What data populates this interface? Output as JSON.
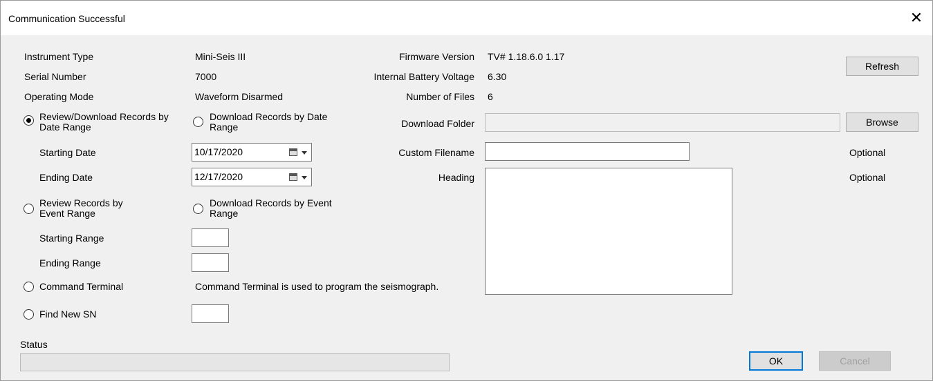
{
  "window": {
    "title": "Communication Successful"
  },
  "info": {
    "instrument_type_label": "Instrument Type",
    "instrument_type_value": "Mini-Seis III",
    "serial_number_label": "Serial Number",
    "serial_number_value": "7000",
    "operating_mode_label": "Operating Mode",
    "operating_mode_value": "Waveform Disarmed",
    "firmware_label": "Firmware Version",
    "firmware_value": "TV# 1.18.6.0 1.17",
    "battery_label": "Internal Battery Voltage",
    "battery_value": "6.30",
    "files_label": "Number of Files",
    "files_value": "6"
  },
  "options": {
    "review_date": "Review/Download Records by Date Range",
    "download_date": "Download Records by Date Range",
    "review_event": "Review Records by Event Range",
    "download_event": "Download Records by Event Range",
    "command_terminal": "Command Terminal",
    "find_sn": "Find New SN",
    "selected": "review_date"
  },
  "dates": {
    "starting_label": "Starting Date",
    "starting_value": "10/17/2020",
    "ending_label": "Ending Date",
    "ending_value": "12/17/2020"
  },
  "ranges": {
    "starting_label": "Starting Range",
    "ending_label": "Ending Range"
  },
  "command_terminal_note": "Command Terminal is used to program the seismograph.",
  "download": {
    "folder_label": "Download Folder",
    "folder_value": "",
    "custom_filename_label": "Custom Filename",
    "custom_filename_value": "",
    "heading_label": "Heading",
    "heading_value": "",
    "optional_1": "Optional",
    "optional_2": "Optional"
  },
  "status": {
    "label": "Status",
    "progress": 0
  },
  "buttons": {
    "refresh": "Refresh",
    "browse": "Browse",
    "ok": "OK",
    "cancel": "Cancel"
  }
}
